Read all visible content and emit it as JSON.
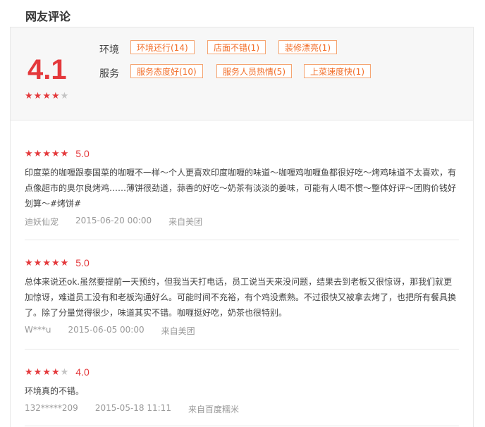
{
  "title": "网友评论",
  "summary": {
    "score": "4.1",
    "star_rating": 4,
    "env_label": "环境",
    "service_label": "服务",
    "env_tags": [
      "环境还行(14)",
      "店面不错(1)",
      "装修漂亮(1)"
    ],
    "service_tags": [
      "服务态度好(10)",
      "服务人员热情(5)",
      "上菜速度快(1)"
    ]
  },
  "reviews": [
    {
      "rating": 5,
      "score": "5.0",
      "text": "印度菜的咖喱跟泰国菜的咖喱不一样～个人更喜欢印度咖喱的味道～咖喱鸡咖喱鱼都很好吃～烤鸡味道不太喜欢，有点像超市的奥尔良烤鸡……薄饼很劲道，蒜香的好吃～奶茶有淡淡的姜味，可能有人喝不惯～整体好评～团购价钱好划算～#烤饼#",
      "user": "迪妖仙宠",
      "date": "2015-06-20 00:00",
      "source": "来自美团"
    },
    {
      "rating": 5,
      "score": "5.0",
      "text": "总体来说还ok.虽然要提前一天预约，但我当天打电话，员工说当天来没问题，结果去到老板又很惊讶，那我们就更加惊讶，难道员工没有和老板沟通好么。可能时间不充裕，有个鸡没煮熟。不过很快又被拿去烤了，也把所有餐具换了。除了分量觉得很少，味道其实不错。咖喱挺好吃，奶茶也很特别。",
      "user": "W***u",
      "date": "2015-06-05 00:00",
      "source": "来自美团"
    },
    {
      "rating": 4,
      "score": "4.0",
      "text": "环境真的不错。",
      "user": "132*****209",
      "date": "2015-05-18 11:11",
      "source": "来自百度糯米"
    }
  ],
  "colors": {
    "accent": "#e4393c",
    "tag": "#f26c26",
    "tag_border": "#f5a572"
  },
  "icons": {
    "star_filled": "star-filled-icon",
    "star_empty": "star-empty-icon"
  }
}
